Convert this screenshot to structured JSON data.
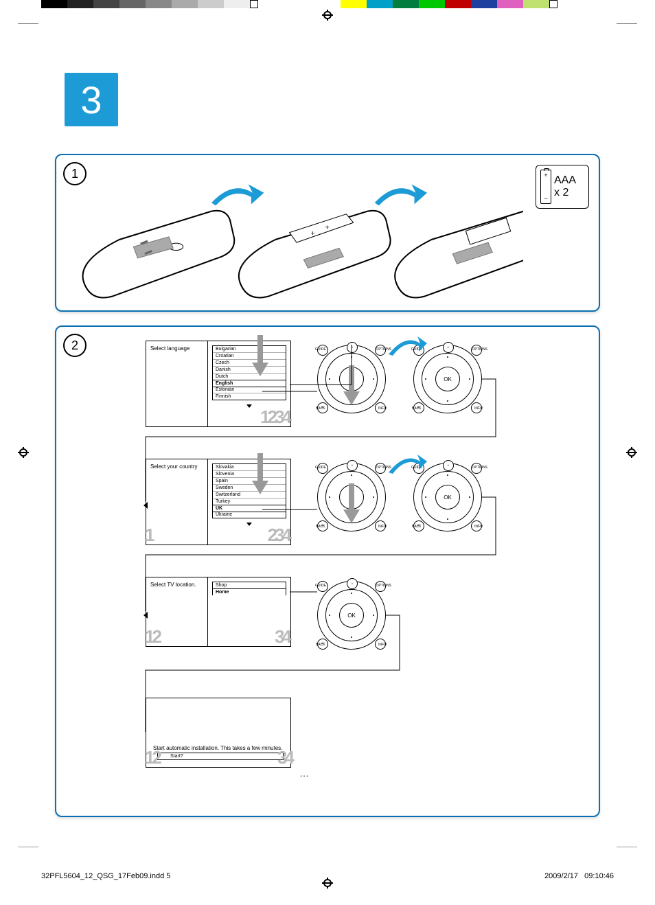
{
  "step_number": "3",
  "panel1": {
    "circle": "1",
    "battery": {
      "label": "AAA",
      "qty": "x 2",
      "plus": "+",
      "minus": "−"
    }
  },
  "panel2": {
    "circle": "2",
    "screens": {
      "language": {
        "title": "Select language",
        "items": [
          "Bulgarian",
          "Croatian",
          "Czech",
          "Danish",
          "Dutch",
          "English",
          "Estonian",
          "Finnish"
        ],
        "selected": "English",
        "bignums": "1234"
      },
      "country": {
        "title": "Select your country",
        "items": [
          "Slovakia",
          "Slovenia",
          "Spain",
          "Sweden",
          "Switzerland",
          "Turkey",
          "UK",
          "Ukraine"
        ],
        "selected": "UK",
        "bignums_left": "1",
        "bignums_right": "234"
      },
      "location": {
        "title": "Select TV location.",
        "items": [
          "Shop",
          "Home"
        ],
        "selected": "Home",
        "bignums_left": "12",
        "bignums_right": "34"
      },
      "install": {
        "text": "Start automatic installation. This takes a few minutes.",
        "button": "Start?",
        "bignums_left": "12",
        "bignums_right": "34"
      }
    },
    "navpad": {
      "ok": "OK",
      "guide": "GUIDE",
      "options": "OPTIONS",
      "back": "BACK",
      "info": "INFO"
    },
    "dots": "…"
  },
  "footer": {
    "file": "32PFL5604_12_QSG_17Feb09.indd   5",
    "date": "2009/2/17",
    "time": "09:10:46"
  }
}
